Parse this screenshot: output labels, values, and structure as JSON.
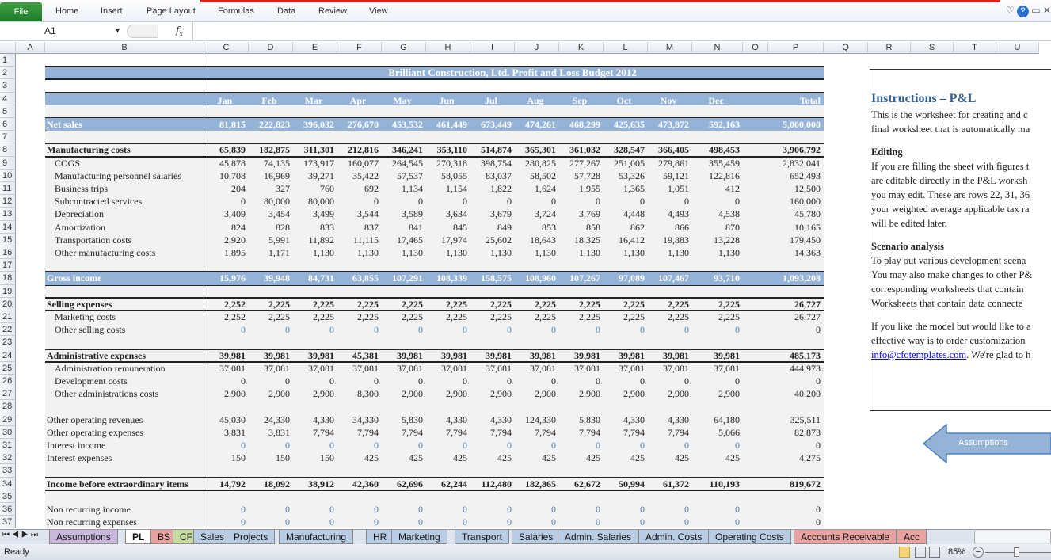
{
  "ribbon": {
    "file": "File",
    "tabs": [
      "Home",
      "Insert",
      "Page Layout",
      "Formulas",
      "Data",
      "Review",
      "View"
    ]
  },
  "formula_bar": {
    "name_box": "A1",
    "fx": "fx",
    "value": ""
  },
  "columns": [
    "A",
    "B",
    "C",
    "D",
    "E",
    "F",
    "G",
    "H",
    "I",
    "J",
    "K",
    "L",
    "M",
    "N",
    "O",
    "P",
    "Q",
    "R",
    "S",
    "T",
    "U"
  ],
  "sheet": {
    "title": "Brilliant Construction, Ltd. Profit and Loss Budget 2012",
    "months": [
      "Jan",
      "Feb",
      "Mar",
      "Apr",
      "May",
      "Jun",
      "Jul",
      "Aug",
      "Sep",
      "Oct",
      "Nov",
      "Dec"
    ],
    "total_label": "Total",
    "rows": [
      {
        "row": 6,
        "style": "band",
        "label": "Net sales",
        "values": [
          "81,815",
          "222,823",
          "396,032",
          "276,670",
          "453,532",
          "461,449",
          "673,449",
          "474,261",
          "468,299",
          "425,635",
          "473,872",
          "592,163",
          "5,000,000"
        ]
      },
      {
        "row": 8,
        "style": "bold",
        "label": "Manufacturing costs",
        "values": [
          "65,839",
          "182,875",
          "311,301",
          "212,816",
          "346,241",
          "353,110",
          "514,874",
          "365,301",
          "361,032",
          "328,547",
          "366,405",
          "498,453",
          "3,906,792"
        ]
      },
      {
        "row": 9,
        "style": "sub",
        "label": "COGS",
        "values": [
          "45,878",
          "74,135",
          "173,917",
          "160,077",
          "264,545",
          "270,318",
          "398,754",
          "280,825",
          "277,267",
          "251,005",
          "279,861",
          "355,459",
          "2,832,041"
        ]
      },
      {
        "row": 10,
        "style": "sub",
        "label": "Manufacturing personnel salaries",
        "values": [
          "10,708",
          "16,969",
          "39,271",
          "35,422",
          "57,537",
          "58,055",
          "83,037",
          "58,502",
          "57,728",
          "53,326",
          "59,121",
          "122,816",
          "652,493"
        ]
      },
      {
        "row": 11,
        "style": "sub",
        "label": "Business trips",
        "values": [
          "204",
          "327",
          "760",
          "692",
          "1,134",
          "1,154",
          "1,822",
          "1,624",
          "1,955",
          "1,365",
          "1,051",
          "412",
          "12,500"
        ]
      },
      {
        "row": 12,
        "style": "sub",
        "label": "Subcontracted services",
        "values": [
          "0",
          "80,000",
          "80,000",
          "0",
          "0",
          "0",
          "0",
          "0",
          "0",
          "0",
          "0",
          "0",
          "160,000"
        ]
      },
      {
        "row": 13,
        "style": "sub",
        "label": "Depreciation",
        "values": [
          "3,409",
          "3,454",
          "3,499",
          "3,544",
          "3,589",
          "3,634",
          "3,679",
          "3,724",
          "3,769",
          "4,448",
          "4,493",
          "4,538",
          "45,780"
        ]
      },
      {
        "row": 14,
        "style": "sub",
        "label": "Amortization",
        "values": [
          "824",
          "828",
          "833",
          "837",
          "841",
          "845",
          "849",
          "853",
          "858",
          "862",
          "866",
          "870",
          "10,165"
        ]
      },
      {
        "row": 15,
        "style": "sub",
        "label": "Transportation costs",
        "values": [
          "2,920",
          "5,991",
          "11,892",
          "11,115",
          "17,465",
          "17,974",
          "25,602",
          "18,643",
          "18,325",
          "16,412",
          "19,883",
          "13,228",
          "179,450"
        ]
      },
      {
        "row": 16,
        "style": "sub",
        "label": "Other manufacturing costs",
        "values": [
          "1,895",
          "1,171",
          "1,130",
          "1,130",
          "1,130",
          "1,130",
          "1,130",
          "1,130",
          "1,130",
          "1,130",
          "1,130",
          "1,130",
          "14,363"
        ]
      },
      {
        "row": 18,
        "style": "band",
        "label": "Gross income",
        "values": [
          "15,976",
          "39,948",
          "84,731",
          "63,855",
          "107,291",
          "108,339",
          "158,575",
          "108,960",
          "107,267",
          "97,089",
          "107,467",
          "93,710",
          "1,093,208"
        ]
      },
      {
        "row": 20,
        "style": "bold",
        "label": "Selling expenses",
        "values": [
          "2,252",
          "2,225",
          "2,225",
          "2,225",
          "2,225",
          "2,225",
          "2,225",
          "2,225",
          "2,225",
          "2,225",
          "2,225",
          "2,225",
          "26,727"
        ]
      },
      {
        "row": 21,
        "style": "sub",
        "label": "Marketing costs",
        "values": [
          "2,252",
          "2,225",
          "2,225",
          "2,225",
          "2,225",
          "2,225",
          "2,225",
          "2,225",
          "2,225",
          "2,225",
          "2,225",
          "2,225",
          "26,727"
        ]
      },
      {
        "row": 22,
        "style": "subblue",
        "label": "Other selling costs",
        "values": [
          "0",
          "0",
          "0",
          "0",
          "0",
          "0",
          "0",
          "0",
          "0",
          "0",
          "0",
          "0",
          "0"
        ]
      },
      {
        "row": 24,
        "style": "bold",
        "label": "Administrative expenses",
        "values": [
          "39,981",
          "39,981",
          "39,981",
          "45,381",
          "39,981",
          "39,981",
          "39,981",
          "39,981",
          "39,981",
          "39,981",
          "39,981",
          "39,981",
          "485,173"
        ]
      },
      {
        "row": 25,
        "style": "sub",
        "label": "Administration remuneration",
        "values": [
          "37,081",
          "37,081",
          "37,081",
          "37,081",
          "37,081",
          "37,081",
          "37,081",
          "37,081",
          "37,081",
          "37,081",
          "37,081",
          "37,081",
          "444,973"
        ]
      },
      {
        "row": 26,
        "style": "sub",
        "label": "Development costs",
        "values": [
          "0",
          "0",
          "0",
          "0",
          "0",
          "0",
          "0",
          "0",
          "0",
          "0",
          "0",
          "0",
          "0"
        ]
      },
      {
        "row": 27,
        "style": "sub",
        "label": "Other administrations costs",
        "values": [
          "2,900",
          "2,900",
          "2,900",
          "8,300",
          "2,900",
          "2,900",
          "2,900",
          "2,900",
          "2,900",
          "2,900",
          "2,900",
          "2,900",
          "40,200"
        ]
      },
      {
        "row": 29,
        "style": "plain",
        "label": "Other operating revenues",
        "values": [
          "45,030",
          "24,330",
          "4,330",
          "34,330",
          "5,830",
          "4,330",
          "4,330",
          "124,330",
          "5,830",
          "4,330",
          "4,330",
          "64,180",
          "325,511"
        ]
      },
      {
        "row": 30,
        "style": "plain",
        "label": "Other operating expenses",
        "values": [
          "3,831",
          "3,831",
          "7,794",
          "7,794",
          "7,794",
          "7,794",
          "7,794",
          "7,794",
          "7,794",
          "7,794",
          "7,794",
          "5,066",
          "82,873"
        ]
      },
      {
        "row": 31,
        "style": "plainblue",
        "label": "Interest income",
        "values": [
          "0",
          "0",
          "0",
          "0",
          "0",
          "0",
          "0",
          "0",
          "0",
          "0",
          "0",
          "0",
          "0"
        ]
      },
      {
        "row": 32,
        "style": "plain",
        "label": "Interest expenses",
        "values": [
          "150",
          "150",
          "150",
          "425",
          "425",
          "425",
          "425",
          "425",
          "425",
          "425",
          "425",
          "425",
          "4,275"
        ]
      },
      {
        "row": 34,
        "style": "bold",
        "label": "Income before extraordinary items",
        "values": [
          "14,792",
          "18,092",
          "38,912",
          "42,360",
          "62,696",
          "62,244",
          "112,480",
          "182,865",
          "62,672",
          "50,994",
          "61,372",
          "110,193",
          "819,672"
        ]
      },
      {
        "row": 36,
        "style": "plainblue",
        "label": "Non recurring income",
        "values": [
          "0",
          "0",
          "0",
          "0",
          "0",
          "0",
          "0",
          "0",
          "0",
          "0",
          "0",
          "0",
          "0"
        ]
      },
      {
        "row": 37,
        "style": "plainblue",
        "label": "Non recurring expenses",
        "values": [
          "0",
          "0",
          "0",
          "0",
          "0",
          "0",
          "0",
          "0",
          "0",
          "0",
          "0",
          "0",
          "0"
        ]
      }
    ]
  },
  "instructions": {
    "title": "Instructions – P&L",
    "intro": [
      "This is the worksheet for creating and c",
      "final worksheet that is automatically ma"
    ],
    "editing_title": "Editing",
    "editing": [
      "If you are filling the sheet with figures t",
      "are editable directly in the P&L worksh",
      "you may edit. These are rows 22, 31, 36",
      "your weighted average applicable tax ra",
      "will be edited later."
    ],
    "scenario_title": "Scenario analysis",
    "scenario": [
      "To play out various development scena",
      "You may also make changes to other P&",
      "corresponding worksheets that contain",
      "Worksheets that contain data connecte"
    ],
    "custom": [
      "If you like the model but would like to a",
      "effective way is to order customization "
    ],
    "email": "info@cfotemplates.com",
    "email_tail": ". We're glad to h"
  },
  "assumptions_button": "Assumptions",
  "sheet_tabs": [
    {
      "name": "Assumptions",
      "color": "#c9b8dc"
    },
    {
      "name": "PL",
      "color": "#ffffff",
      "active": true
    },
    {
      "name": "BS",
      "color": "#e6a3a0"
    },
    {
      "name": "CF",
      "color": "#c6dba0"
    },
    {
      "name": "Sales",
      "color": "#b8cce4"
    },
    {
      "name": "Projects",
      "color": "#b8cce4"
    },
    {
      "name": "Manufacturing",
      "color": "#b8cce4"
    },
    {
      "name": "HR",
      "color": "#b8cce4"
    },
    {
      "name": "Marketing",
      "color": "#b8cce4"
    },
    {
      "name": "Transport",
      "color": "#b8cce4"
    },
    {
      "name": "Salaries",
      "color": "#b8cce4"
    },
    {
      "name": "Admin. Salaries",
      "color": "#b8cce4"
    },
    {
      "name": "Admin. Costs",
      "color": "#b8cce4"
    },
    {
      "name": "Operating Costs",
      "color": "#b8cce4"
    },
    {
      "name": "Accounts Receivable",
      "color": "#e6a3a0"
    },
    {
      "name": "Acc",
      "color": "#e6a3a0"
    }
  ],
  "status": {
    "text": "Ready",
    "zoom": "85%"
  }
}
